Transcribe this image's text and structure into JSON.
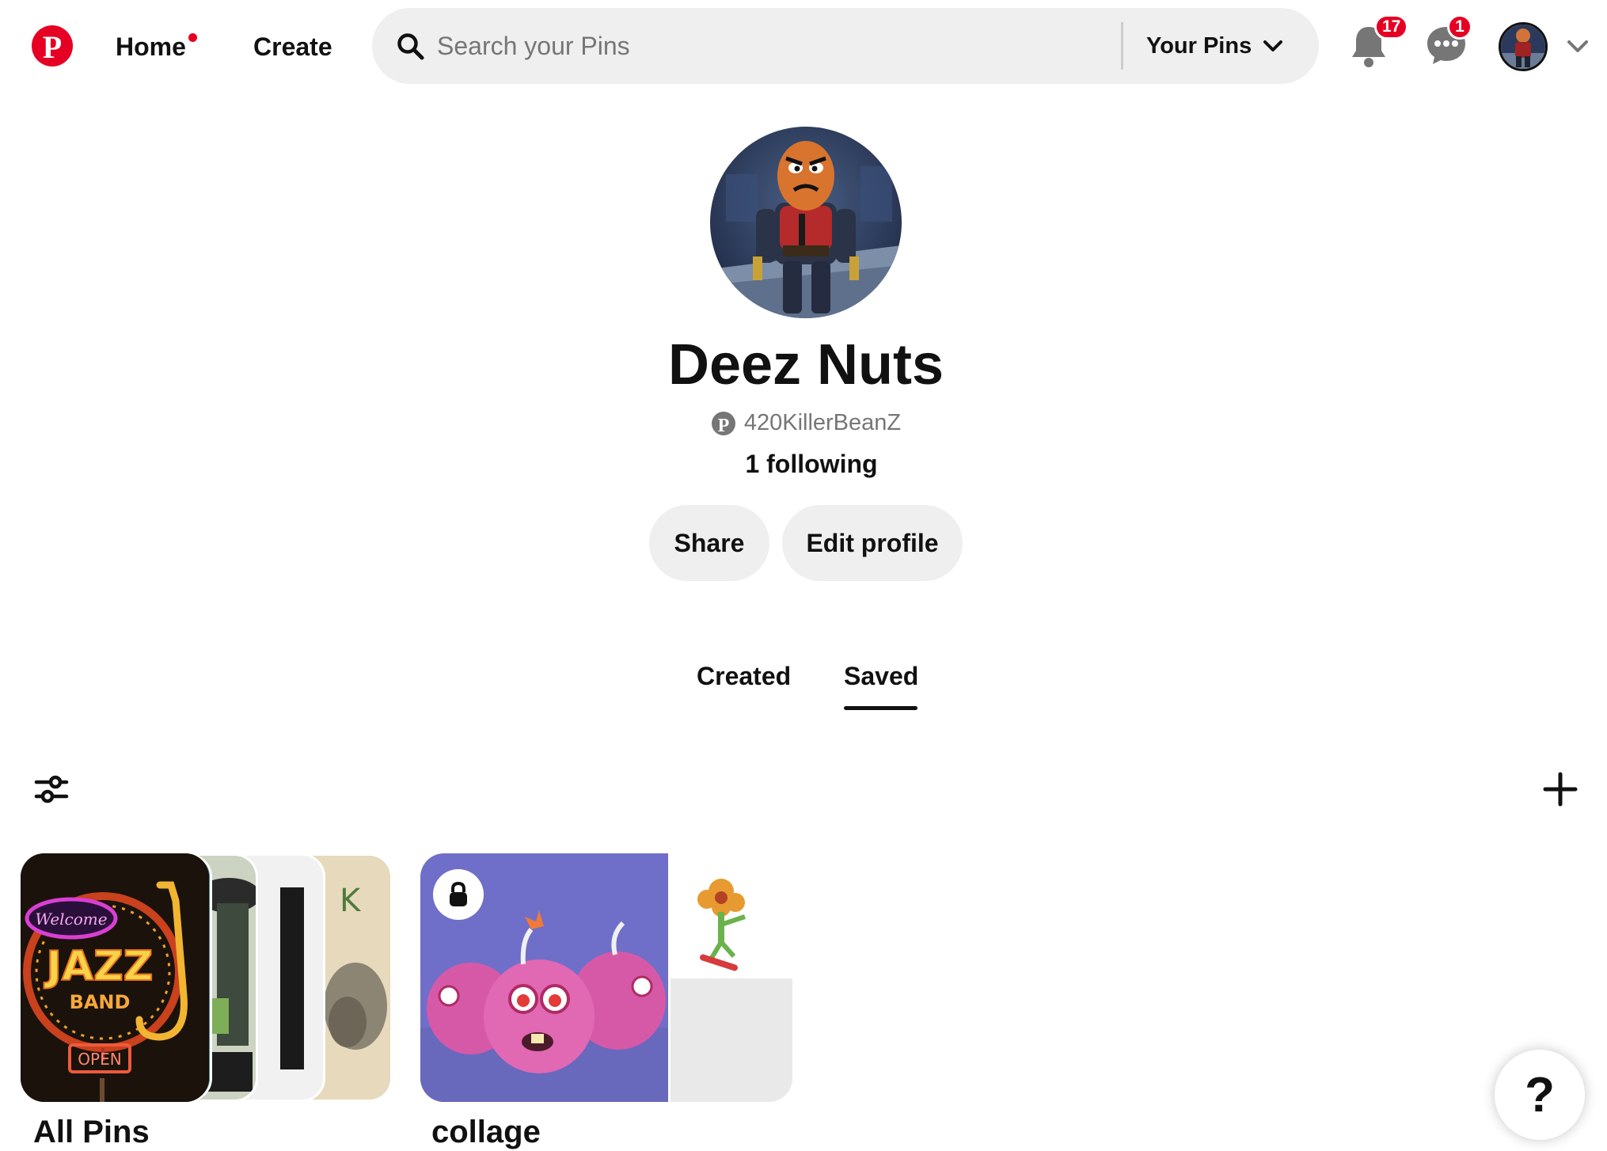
{
  "header": {
    "home_label": "Home",
    "create_label": "Create",
    "search": {
      "placeholder": "Search your Pins",
      "value": ""
    },
    "scope_label": "Your Pins",
    "notifications_count": "17",
    "messages_count": "1"
  },
  "profile": {
    "name": "Deez Nuts",
    "username": "420KillerBeanZ",
    "following_text": "1 following",
    "share_label": "Share",
    "edit_label": "Edit profile"
  },
  "tabs": [
    {
      "label": "Created",
      "active": false
    },
    {
      "label": "Saved",
      "active": true
    }
  ],
  "boards": [
    {
      "title": "All Pins",
      "neon_welcome": "Welcome",
      "neon_jazz": "JAZZ",
      "neon_band": "BAND",
      "neon_open": "OPEN"
    },
    {
      "title": "collage",
      "private": true
    }
  ],
  "help_label": "?",
  "icons": {
    "logo": "pinterest-logo-icon",
    "search": "search-icon",
    "scope_chevron": "chevron-down-icon",
    "notifications": "bell-icon",
    "messages": "chat-bubble-icon",
    "account_chevron": "chevron-down-icon",
    "username_logo": "pinterest-logo-icon",
    "filter": "filter-sliders-icon",
    "add": "plus-icon",
    "private_board": "lock-icon"
  },
  "colors": {
    "brand_red": "#e60023",
    "pill_gray": "#efefef",
    "text_primary": "#111111",
    "text_secondary": "#767676"
  }
}
